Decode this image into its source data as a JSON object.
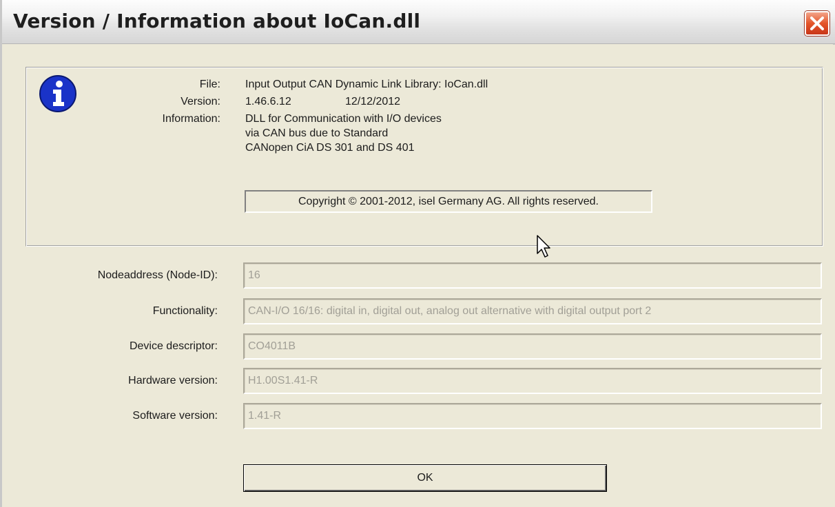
{
  "window": {
    "title": "Version / Information about IoCan.dll",
    "close_icon": "close-icon",
    "close_color": "#e4552a"
  },
  "info": {
    "icon": "info-icon",
    "icon_color": "#1a33c8",
    "file_label": "File:",
    "file_value": "Input Output CAN Dynamic Link Library: IoCan.dll",
    "version_label": "Version:",
    "version_number": "1.46.6.12",
    "version_date": "12/12/2012",
    "information_label": "Information:",
    "information_lines": [
      "DLL for Communication with I/O devices",
      "via CAN bus due to Standard",
      "CANopen CiA DS 301 and DS 401"
    ],
    "copyright": "Copyright © 2001-2012, isel Germany AG. All rights reserved."
  },
  "fields": [
    {
      "label": "Nodeaddress (Node-ID):",
      "value": "16"
    },
    {
      "label": "Functionality:",
      "value": "CAN-I/O 16/16: digital in, digital out, analog out alternative with digital output port 2"
    },
    {
      "label": "Device descriptor:",
      "value": "CO4011B"
    },
    {
      "label": "Hardware version:",
      "value": "H1.00S1.41-R"
    },
    {
      "label": "Software version:",
      "value": "1.41-R"
    }
  ],
  "buttons": {
    "ok_label": "OK"
  }
}
